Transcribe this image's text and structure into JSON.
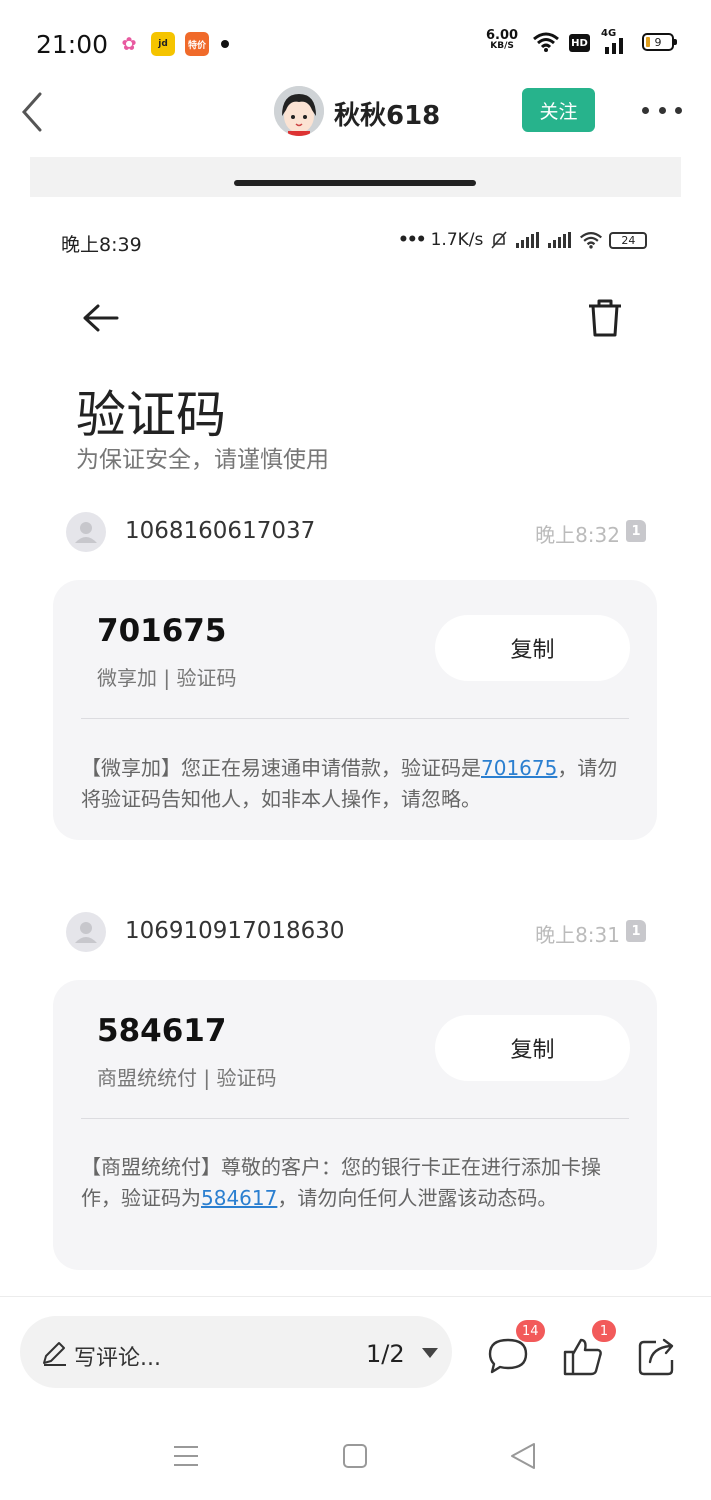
{
  "status_bar": {
    "time": "21:00",
    "app_icons": [
      {
        "name": "flower-app-icon",
        "text": "✿",
        "color": "#e85aa0"
      },
      {
        "name": "news-app-icon",
        "text": "jd",
        "color": "#f5c400"
      },
      {
        "name": "tejia-app-icon",
        "text": "特价",
        "color": "#f06a2a"
      }
    ],
    "net_speed": "6.00",
    "net_unit": "KB/S",
    "hd": "HD",
    "network": "4G",
    "battery": "9"
  },
  "header": {
    "username": "秋秋618",
    "follow_label": "关注"
  },
  "inner_screen": {
    "time": "晚上8:39",
    "speed": "1.7K/s",
    "battery": "24",
    "title": "验证码",
    "subtitle": "为保证安全，请谨慎使用",
    "messages": [
      {
        "sender": "1068160617037",
        "time": "晚上8:32",
        "sim": "1",
        "code": "701675",
        "source": "微享加 | 验证码",
        "copy_label": "复制",
        "body_pre": "【微享加】您正在易速通申请借款，验证码是",
        "body_code": "701675",
        "body_post": "，请勿将验证码告知他人，如非本人操作，请忽略。"
      },
      {
        "sender": "106910917018630",
        "time": "晚上8:31",
        "sim": "1",
        "code": "584617",
        "source": "商盟统统付 | 验证码",
        "copy_label": "复制",
        "body_pre": "【商盟统统付】尊敬的客户：您的银行卡正在进行添加卡操作，验证码为",
        "body_code": "584617",
        "body_post": "，请勿向任何人泄露该动态码。"
      }
    ]
  },
  "bottom_bar": {
    "comment_placeholder": "写评论...",
    "page_indicator": "1/2",
    "comment_count": "14",
    "like_count": "1"
  },
  "colors": {
    "accent": "#27b38c",
    "link": "#2b7fd0",
    "badge": "#f25a5a",
    "card_bg": "#f5f5f7"
  }
}
